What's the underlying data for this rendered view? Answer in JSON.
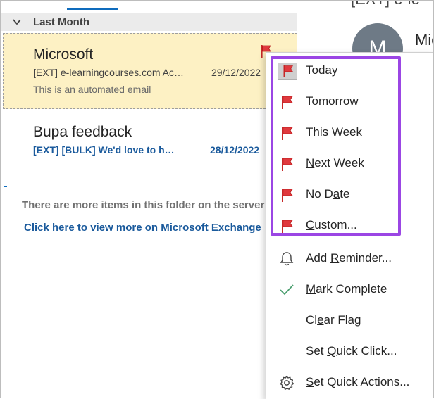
{
  "group": {
    "label": "Last Month"
  },
  "messages": [
    {
      "sender": "Microsoft",
      "subject": "[EXT] e-learningcourses.com Ac…",
      "date": "29/12/2022",
      "preview": "This is an automated email"
    },
    {
      "sender": "Bupa feedback",
      "subject": "[EXT] [BULK] We'd love to h…",
      "date": "28/12/2022"
    }
  ],
  "folder_notice": "There are more items in this folder on the server",
  "view_more_link": "Click here to view more on Microsoft Exchange",
  "reading_pane": {
    "title": "[EXT] e-le",
    "avatar_initial": "M",
    "sender_name": "Mic"
  },
  "menu": {
    "items": [
      {
        "id": "today",
        "pre": "",
        "ul": "T",
        "post": "oday",
        "icon": "red-flag-icon"
      },
      {
        "id": "tomorrow",
        "pre": "T",
        "ul": "o",
        "post": "morrow",
        "icon": "red-flag-icon"
      },
      {
        "id": "this-week",
        "pre": "This ",
        "ul": "W",
        "post": "eek",
        "icon": "red-flag-icon"
      },
      {
        "id": "next-week",
        "pre": "",
        "ul": "N",
        "post": "ext Week",
        "icon": "red-flag-icon"
      },
      {
        "id": "no-date",
        "pre": "No D",
        "ul": "a",
        "post": "te",
        "icon": "red-flag-icon"
      },
      {
        "id": "custom",
        "pre": "",
        "ul": "C",
        "post": "ustom...",
        "icon": "red-flag-icon"
      },
      {
        "id": "add-reminder",
        "pre": "Add ",
        "ul": "R",
        "post": "eminder...",
        "icon": "bell-icon"
      },
      {
        "id": "mark-complete",
        "pre": "",
        "ul": "M",
        "post": "ark Complete",
        "icon": "checkmark-icon"
      },
      {
        "id": "clear-flag",
        "pre": "Cl",
        "ul": "e",
        "post": "ar Flag",
        "icon": ""
      },
      {
        "id": "set-quick-click",
        "pre": "Set ",
        "ul": "Q",
        "post": "uick Click...",
        "icon": ""
      },
      {
        "id": "set-quick-actions",
        "pre": "",
        "ul": "S",
        "post": "et Quick Actions...",
        "icon": "gear-icon"
      }
    ]
  },
  "colors": {
    "accent": "#0f6cbd",
    "selected_bg": "#fdf1c4",
    "flag_red": "#e0393e",
    "highlight": "#9b46e4",
    "check_green": "#4c9f70"
  }
}
